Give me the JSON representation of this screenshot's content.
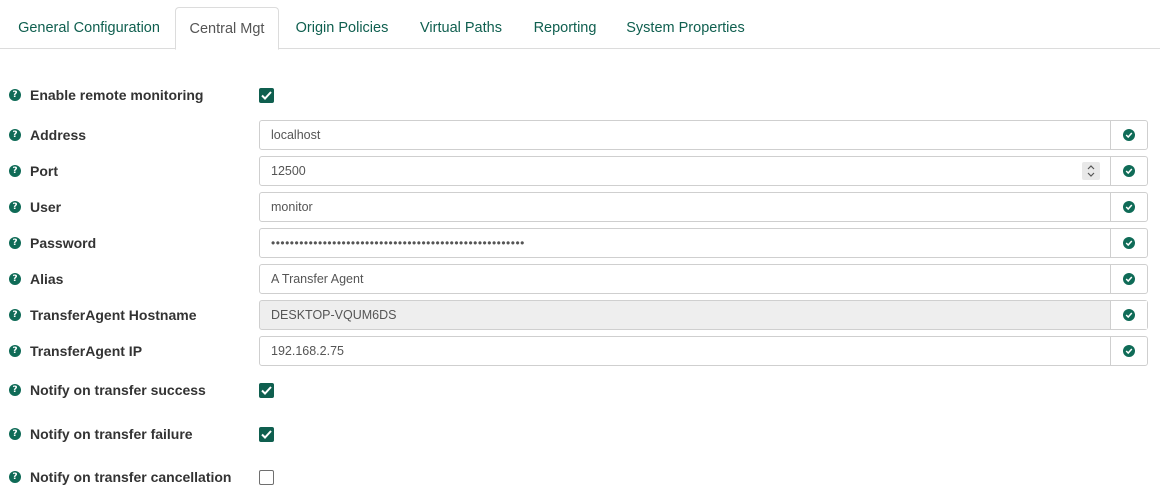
{
  "tabs": [
    {
      "label": "General Configuration",
      "active": false
    },
    {
      "label": "Central Mgt",
      "active": true
    },
    {
      "label": "Origin Policies",
      "active": false
    },
    {
      "label": "Virtual Paths",
      "active": false
    },
    {
      "label": "Reporting",
      "active": false
    },
    {
      "label": "System Properties",
      "active": false
    }
  ],
  "form": {
    "enable_remote_monitoring": {
      "label": "Enable remote monitoring",
      "checked": true
    },
    "address": {
      "label": "Address",
      "value": "localhost"
    },
    "port": {
      "label": "Port",
      "value": "12500"
    },
    "user": {
      "label": "User",
      "value": "monitor"
    },
    "password": {
      "label": "Password",
      "value": "••••••••••••••••••••••••••••••••••••••••••••••••••••••"
    },
    "alias": {
      "label": "Alias",
      "value": "A Transfer Agent"
    },
    "hostname": {
      "label": "TransferAgent Hostname",
      "value": "DESKTOP-VQUM6DS",
      "disabled": true
    },
    "ip": {
      "label": "TransferAgent IP",
      "value": "192.168.2.75"
    },
    "notify_success": {
      "label": "Notify on transfer success",
      "checked": true
    },
    "notify_failure": {
      "label": "Notify on transfer failure",
      "checked": true
    },
    "notify_cancellation": {
      "label": "Notify on transfer cancellation",
      "checked": false
    }
  },
  "icons": {
    "help": "question-circle-icon",
    "valid": "check-circle-icon"
  },
  "colors": {
    "accent": "#0f5f4f",
    "tab_text": "#0f5f4f"
  }
}
